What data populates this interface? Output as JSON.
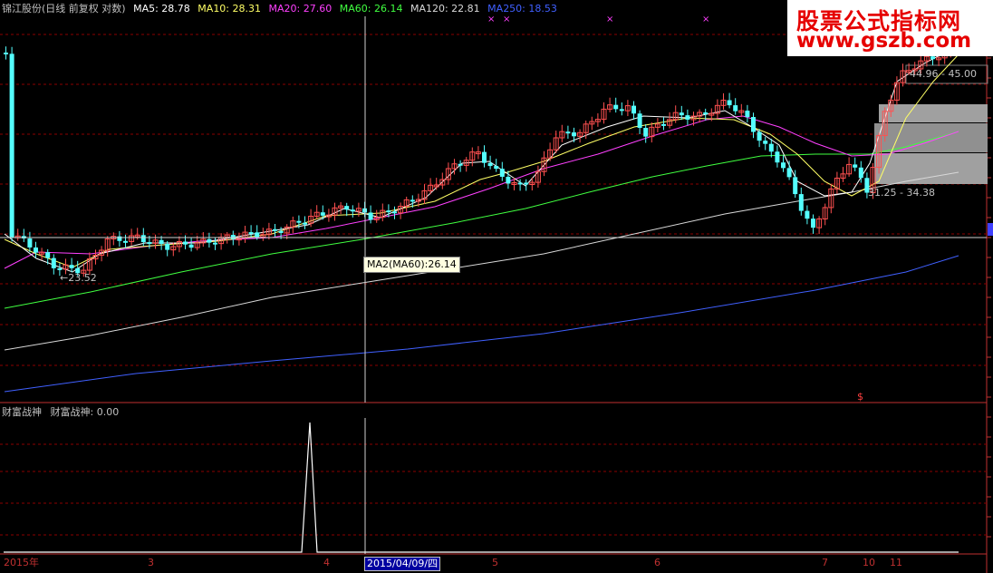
{
  "header": {
    "stock_title": "锦江股份(日线 前复权 对数)",
    "ma_items": [
      {
        "label": "MA5: 28.78",
        "color": "#ffffff"
      },
      {
        "label": "MA10: 28.31",
        "color": "#ffff66"
      },
      {
        "label": "MA20: 27.60",
        "color": "#ff40ff"
      },
      {
        "label": "MA60: 26.14",
        "color": "#40ff40"
      },
      {
        "label": "MA120: 22.81",
        "color": "#d8d8d8"
      },
      {
        "label": "MA250: 18.53",
        "color": "#4060ff"
      }
    ]
  },
  "watermark": {
    "line1": "股票公式指标网",
    "line2": "www.gszb.com"
  },
  "tooltip": {
    "text": "MA2(MA60):26.14"
  },
  "range_labels": {
    "low": "23.52",
    "top_range": "44.96 - 45.00",
    "mid_range": "31.25 - 34.38"
  },
  "sub_panel": {
    "title": "财富战神",
    "value_label": "财富战神: 0.00"
  },
  "bottom_axis": {
    "labels": [
      "2015年",
      "3",
      "4",
      "5",
      "6",
      "7",
      "10",
      "11"
    ],
    "cursor_date": "2015/04/09/四"
  },
  "markers": {
    "signal": "$"
  },
  "colors": {
    "up": "#ff5050",
    "down": "#54ffff",
    "grid": "#8c0000",
    "axis_text": "#c03030",
    "ma5": "#ffffff",
    "ma10": "#ffff66",
    "ma20": "#ff40ff",
    "ma60": "#40ff40",
    "ma120": "#d8d8d8",
    "ma250": "#4060ff"
  }
}
